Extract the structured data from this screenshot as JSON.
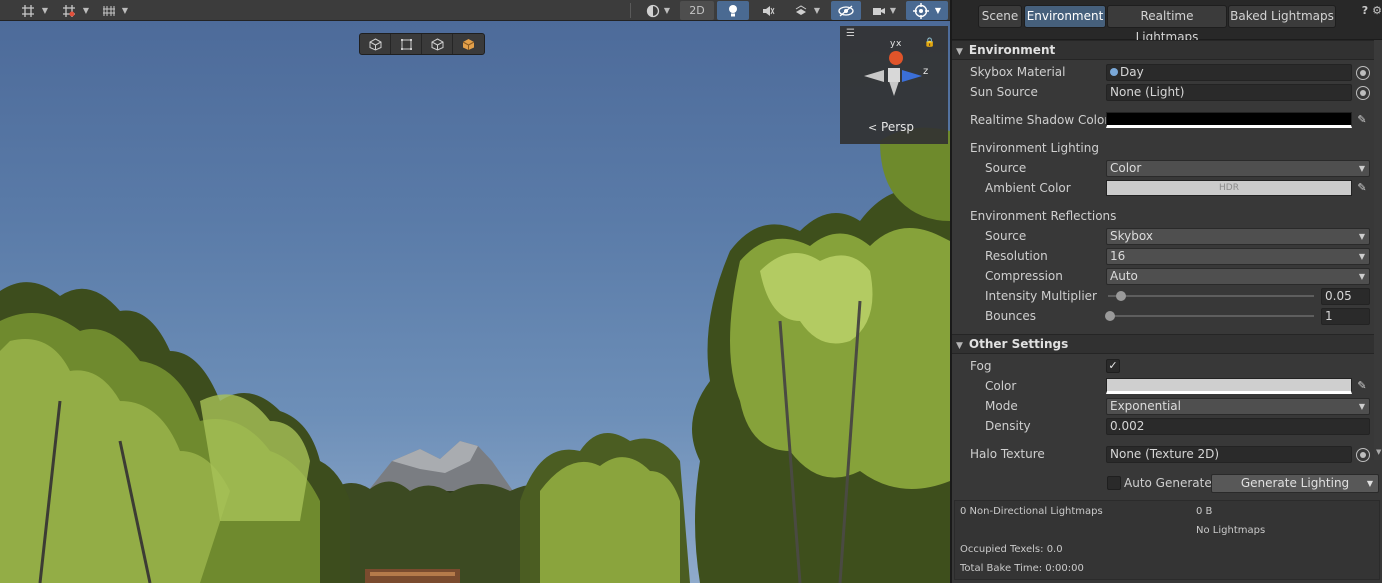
{
  "scene_toolbar": {
    "two_d_label": "2D"
  },
  "scene_view": {
    "camera_label": "Persp",
    "gizmo_axes": {
      "y": "y",
      "x": "x",
      "z": "z"
    }
  },
  "lighting": {
    "tabs": [
      "Scene",
      "Environment",
      "Realtime Lightmaps",
      "Baked Lightmaps"
    ],
    "selected_tab": "Environment",
    "environment": {
      "header": "Environment",
      "skybox_material_label": "Skybox Material",
      "skybox_material_value": "Day",
      "sun_source_label": "Sun Source",
      "sun_source_value": "None (Light)",
      "realtime_shadow_color_label": "Realtime Shadow Color",
      "realtime_shadow_color": "#000000",
      "env_lighting_label": "Environment Lighting",
      "source_label": "Source",
      "source_value": "Color",
      "ambient_color_label": "Ambient Color",
      "ambient_color": "#cbcbcb",
      "ambient_hdr_label": "HDR",
      "env_reflections_label": "Environment Reflections",
      "refl_source_label": "Source",
      "refl_source_value": "Skybox",
      "resolution_label": "Resolution",
      "resolution_value": "16",
      "compression_label": "Compression",
      "compression_value": "Auto",
      "intensity_label": "Intensity Multiplier",
      "intensity_value": "0.05",
      "bounces_label": "Bounces",
      "bounces_value": "1"
    },
    "other_settings": {
      "header": "Other Settings",
      "fog_label": "Fog",
      "fog_enabled": true,
      "fog_check": "✓",
      "color_label": "Color",
      "fog_color": "#cfcfcf",
      "mode_label": "Mode",
      "mode_value": "Exponential",
      "density_label": "Density",
      "density_value": "0.002",
      "halo_label": "Halo Texture",
      "halo_value": "None (Texture 2D)"
    },
    "bake": {
      "auto_generate_label": "Auto Generate",
      "auto_generate": false,
      "generate_button": "Generate Lighting"
    },
    "stats": {
      "lightmaps": "0 Non-Directional Lightmaps",
      "size": "0 B",
      "no_lightmaps": "No Lightmaps",
      "occupied": "Occupied Texels: 0.0",
      "bake_time": "Total Bake Time: 0:00:00"
    }
  }
}
